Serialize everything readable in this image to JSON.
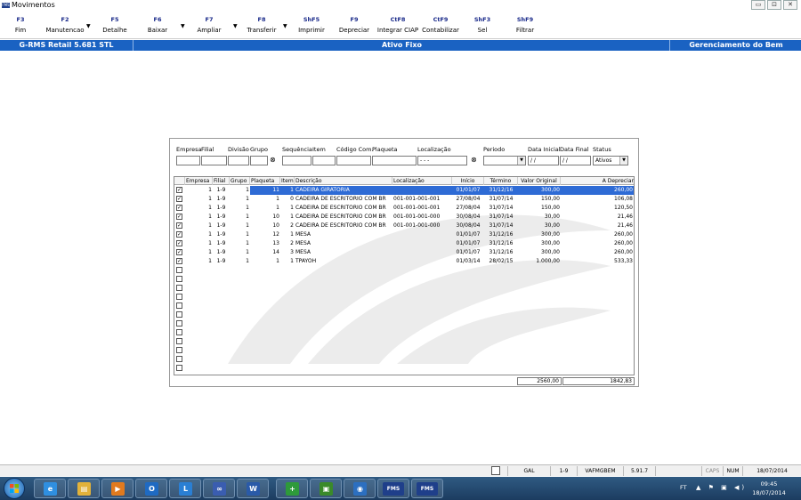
{
  "window": {
    "title": "Movimentos",
    "logo": "FMS",
    "buttons": {
      "minimize": "▭",
      "maximize": "⊡",
      "close": "✕"
    }
  },
  "toolbar": [
    {
      "key": "F3",
      "label": "Fim",
      "arrow": false
    },
    {
      "key": "F2",
      "label": "Manutencao",
      "arrow": true
    },
    {
      "key": "F5",
      "label": "Detalhe",
      "arrow": false
    },
    {
      "key": "F6",
      "label": "Baixar",
      "arrow": true
    },
    {
      "key": "F7",
      "label": "Ampliar",
      "arrow": true
    },
    {
      "key": "F8",
      "label": "Transferir",
      "arrow": true
    },
    {
      "key": "ShF5",
      "label": "Imprimir",
      "arrow": false
    },
    {
      "key": "F9",
      "label": "Depreciar",
      "arrow": false
    },
    {
      "key": "CtF8",
      "label": "Integrar CIAP",
      "arrow": false
    },
    {
      "key": "CtF9",
      "label": "Contabilizar",
      "arrow": false
    },
    {
      "key": "ShF3",
      "label": "Sel",
      "arrow": false
    },
    {
      "key": "ShF9",
      "label": "Filtrar",
      "arrow": false
    }
  ],
  "header": {
    "left": "G-RMS Retail 5.681 STL",
    "center": "Ativo Fixo",
    "right": "Gerenciamento do Bem"
  },
  "filters": {
    "labels": {
      "empresa": "Empresa",
      "filial": "Filial",
      "divisao": "Divisão",
      "grupo": "Grupo",
      "sequencia": "Sequência",
      "item": "Item",
      "codigo": "Código Com.",
      "plaqueta": "Plaqueta",
      "localizacao": "Localização",
      "periodo": "Periodo",
      "data_inicial": "Data Inicial",
      "data_final": "Data Final",
      "status": "Status"
    },
    "values": {
      "localizacao": " -  -  - ",
      "data_inicial": " / /",
      "data_final": " / /",
      "status": "Ativos",
      "periodo": ""
    }
  },
  "grid": {
    "columns": [
      "Empresa",
      "Filial",
      "Grupo",
      "Plaqueta",
      "Item",
      "Descrição",
      "Localização",
      "Início",
      "Término",
      "Valor Original",
      "A Depreciar"
    ],
    "rows": [
      {
        "checked": true,
        "empresa": "1",
        "filial": "1-9",
        "grupo": "1",
        "plaqueta": "11",
        "item": "1",
        "descricao": "CADEIRA GIRATORIA",
        "localizacao": "",
        "inicio": "01/01/07",
        "termino": "31/12/16",
        "valor": "300,00",
        "depreciar": "260,00",
        "selected": true
      },
      {
        "checked": true,
        "empresa": "1",
        "filial": "1-9",
        "grupo": "1",
        "plaqueta": "1",
        "item": "0",
        "descricao": "CADEIRA DE ESCRITORIO COM BR",
        "localizacao": "001-001-001-001",
        "inicio": "27/08/04",
        "termino": "31/07/14",
        "valor": "150,00",
        "depreciar": "106,08",
        "selected": false
      },
      {
        "checked": true,
        "empresa": "1",
        "filial": "1-9",
        "grupo": "1",
        "plaqueta": "1",
        "item": "1",
        "descricao": "CADEIRA DE ESCRITORIO COM BR",
        "localizacao": "001-001-001-001",
        "inicio": "27/08/04",
        "termino": "31/07/14",
        "valor": "150,00",
        "depreciar": "120,50",
        "selected": false
      },
      {
        "checked": true,
        "empresa": "1",
        "filial": "1-9",
        "grupo": "1",
        "plaqueta": "10",
        "item": "1",
        "descricao": "CADEIRA DE ESCRITORIO COM BR",
        "localizacao": "001-001-001-000",
        "inicio": "30/08/04",
        "termino": "31/07/14",
        "valor": "30,00",
        "depreciar": "21,46",
        "selected": false
      },
      {
        "checked": true,
        "empresa": "1",
        "filial": "1-9",
        "grupo": "1",
        "plaqueta": "10",
        "item": "2",
        "descricao": "CADEIRA DE ESCRITORIO COM BR",
        "localizacao": "001-001-001-000",
        "inicio": "30/08/04",
        "termino": "31/07/14",
        "valor": "30,00",
        "depreciar": "21,46",
        "selected": false
      },
      {
        "checked": true,
        "empresa": "1",
        "filial": "1-9",
        "grupo": "1",
        "plaqueta": "12",
        "item": "1",
        "descricao": "MESA",
        "localizacao": "",
        "inicio": "01/01/07",
        "termino": "31/12/16",
        "valor": "300,00",
        "depreciar": "260,00",
        "selected": false
      },
      {
        "checked": true,
        "empresa": "1",
        "filial": "1-9",
        "grupo": "1",
        "plaqueta": "13",
        "item": "2",
        "descricao": "MESA",
        "localizacao": "",
        "inicio": "01/01/07",
        "termino": "31/12/16",
        "valor": "300,00",
        "depreciar": "260,00",
        "selected": false
      },
      {
        "checked": true,
        "empresa": "1",
        "filial": "1-9",
        "grupo": "1",
        "plaqueta": "14",
        "item": "3",
        "descricao": "MESA",
        "localizacao": "",
        "inicio": "01/01/07",
        "termino": "31/12/16",
        "valor": "300,00",
        "depreciar": "260,00",
        "selected": false
      },
      {
        "checked": true,
        "empresa": "1",
        "filial": "1-9",
        "grupo": "1",
        "plaqueta": "1",
        "item": "1",
        "descricao": "TPAYOH",
        "localizacao": "",
        "inicio": "01/03/14",
        "termino": "28/02/15",
        "valor": "1.000,00",
        "depreciar": "533,33",
        "selected": false
      }
    ],
    "empty_rows": 12,
    "totals": {
      "valor": "2560,00",
      "depreciar": "1842,83"
    }
  },
  "statusbar": {
    "cells": [
      "GAL",
      "1-9",
      "VAFMGBEM",
      "5.91.7",
      "",
      "CAPS",
      "NUM",
      "18/07/2014"
    ]
  },
  "taskbar": {
    "apps": [
      {
        "name": "internet-explorer",
        "glyph": "e",
        "color": "#2f8fe0"
      },
      {
        "name": "file-explorer",
        "glyph": "▤",
        "color": "#e2b23a"
      },
      {
        "name": "media-player",
        "glyph": "▶",
        "color": "#e07a1f"
      },
      {
        "name": "outlook",
        "glyph": "O",
        "color": "#1f6ac2"
      },
      {
        "name": "lync",
        "glyph": "L",
        "color": "#2a7fd4"
      },
      {
        "name": "app-eye",
        "glyph": "∞",
        "color": "#3a5db0"
      },
      {
        "name": "word",
        "glyph": "W",
        "color": "#2a5aa8"
      },
      {
        "name": "app-green-plus",
        "glyph": "+",
        "color": "#2e9a3a"
      },
      {
        "name": "app-green-box",
        "glyph": "▣",
        "color": "#3a8a2a"
      },
      {
        "name": "app-globe",
        "glyph": "◉",
        "color": "#2c6fc0"
      },
      {
        "name": "fms-1",
        "glyph": "FMS",
        "color": "#1f3f8a"
      },
      {
        "name": "fms-2",
        "glyph": "FMS",
        "color": "#1f3f8a"
      }
    ],
    "tray": {
      "lang": "FT",
      "icons": "▲ ⚑ ▣ ◀)",
      "time": "09:45",
      "date": "18/07/2014"
    }
  }
}
